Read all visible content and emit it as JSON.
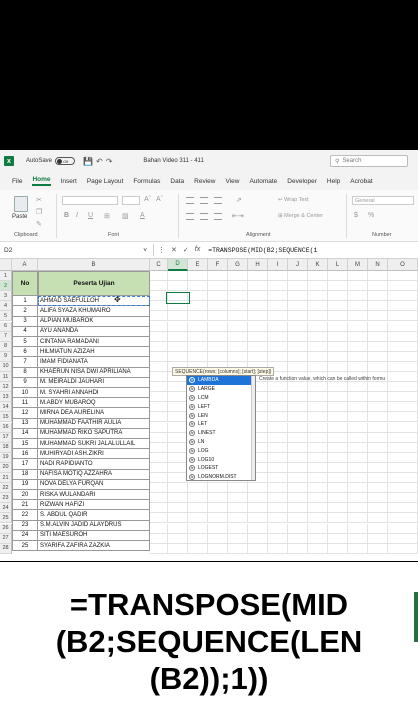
{
  "titlebar": {
    "autosave_label": "AutoSave",
    "toggle_state": "Off",
    "document_title": "Bahan Video 311 - 411",
    "search_placeholder": "Search"
  },
  "ribbon_tabs": [
    "File",
    "Home",
    "Insert",
    "Page Layout",
    "Formulas",
    "Data",
    "Review",
    "View",
    "Automate",
    "Developer",
    "Help",
    "Acrobat"
  ],
  "active_tab": "Home",
  "ribbon": {
    "paste_label": "Paste",
    "clipboard_label": "Clipboard",
    "font_label": "Font",
    "alignment_label": "Alignment",
    "number_label": "Number",
    "wrap_text": "Wrap Text",
    "merge_center": "Merge & Center",
    "number_format": "General"
  },
  "formula_bar": {
    "name_box": "D2",
    "formula": "=TRANSPOSE(MID(B2;SEQUENCE(1"
  },
  "columns": [
    "A",
    "B",
    "C",
    "D",
    "E",
    "F",
    "G",
    "H",
    "I",
    "J",
    "K",
    "L",
    "M",
    "N",
    "O"
  ],
  "table": {
    "header_no": "No",
    "header_name": "Peserta Ujian",
    "rows": [
      {
        "no": "1",
        "name": "AHMAD SAEFULLOH"
      },
      {
        "no": "2",
        "name": "ALIFA SYAZA KHUMAIRO"
      },
      {
        "no": "3",
        "name": "ALPIAN MUBAROK"
      },
      {
        "no": "4",
        "name": "AYU ANANDA"
      },
      {
        "no": "5",
        "name": "CINTANA RAMADANI"
      },
      {
        "no": "6",
        "name": "HILMIATUN AZIZAH"
      },
      {
        "no": "7",
        "name": "IMAM FIDIANATA"
      },
      {
        "no": "8",
        "name": "KHAERUN NISA DWI APRILIANA"
      },
      {
        "no": "9",
        "name": "M. MEIRALDI JAUHARI"
      },
      {
        "no": "10",
        "name": "M. SYAHRI ANNAHDI"
      },
      {
        "no": "11",
        "name": "M.ABDY MUBAROQ"
      },
      {
        "no": "12",
        "name": "MIRNA DEA AURELINA"
      },
      {
        "no": "13",
        "name": "MUHAMMAD FAATHIR AULIA"
      },
      {
        "no": "14",
        "name": "MUHAMMAD RIKO SAPUTRA"
      },
      {
        "no": "15",
        "name": "MUHAMMAD SUKRI JALALULLAIL"
      },
      {
        "no": "16",
        "name": "MUHIRYADI ASH.ZIKRI"
      },
      {
        "no": "17",
        "name": "NADI RAPIDIANTO"
      },
      {
        "no": "18",
        "name": "NAFISA MOTIQ AZZAHRA"
      },
      {
        "no": "19",
        "name": "NOVA DELYA FURQAN"
      },
      {
        "no": "20",
        "name": "RISKA WULANDARI"
      },
      {
        "no": "21",
        "name": "RIZWAN HAFIZI"
      },
      {
        "no": "22",
        "name": "S. ABDUL QADIR"
      },
      {
        "no": "23",
        "name": "S.M.ALVIN JADID ALAYDRUS"
      },
      {
        "no": "24",
        "name": "SITI MAESUROH"
      },
      {
        "no": "25",
        "name": "SYARIFA ZAFIRA ZAZKIA"
      }
    ]
  },
  "tooltip": "SEQUENCE(rows; [columns]; [start]; [step])",
  "autocomplete": {
    "items": [
      "LAMBDA",
      "LARGE",
      "LCM",
      "LEFT",
      "LEN",
      "LET",
      "LINEST",
      "LN",
      "LOG",
      "LOG10",
      "LOGEST",
      "LOGNORM.DIST"
    ],
    "selected_index": 0,
    "description": "Create a function value, which can be called within formu"
  },
  "caption_lines": [
    "=TRANSPOSE(MID",
    "(B2;SEQUENCE(LEN",
    "(B2));1))"
  ],
  "colors": {
    "excel_green": "#107c41",
    "header_fill": "#c6e0b4",
    "selection_blue": "#1e73d8"
  }
}
